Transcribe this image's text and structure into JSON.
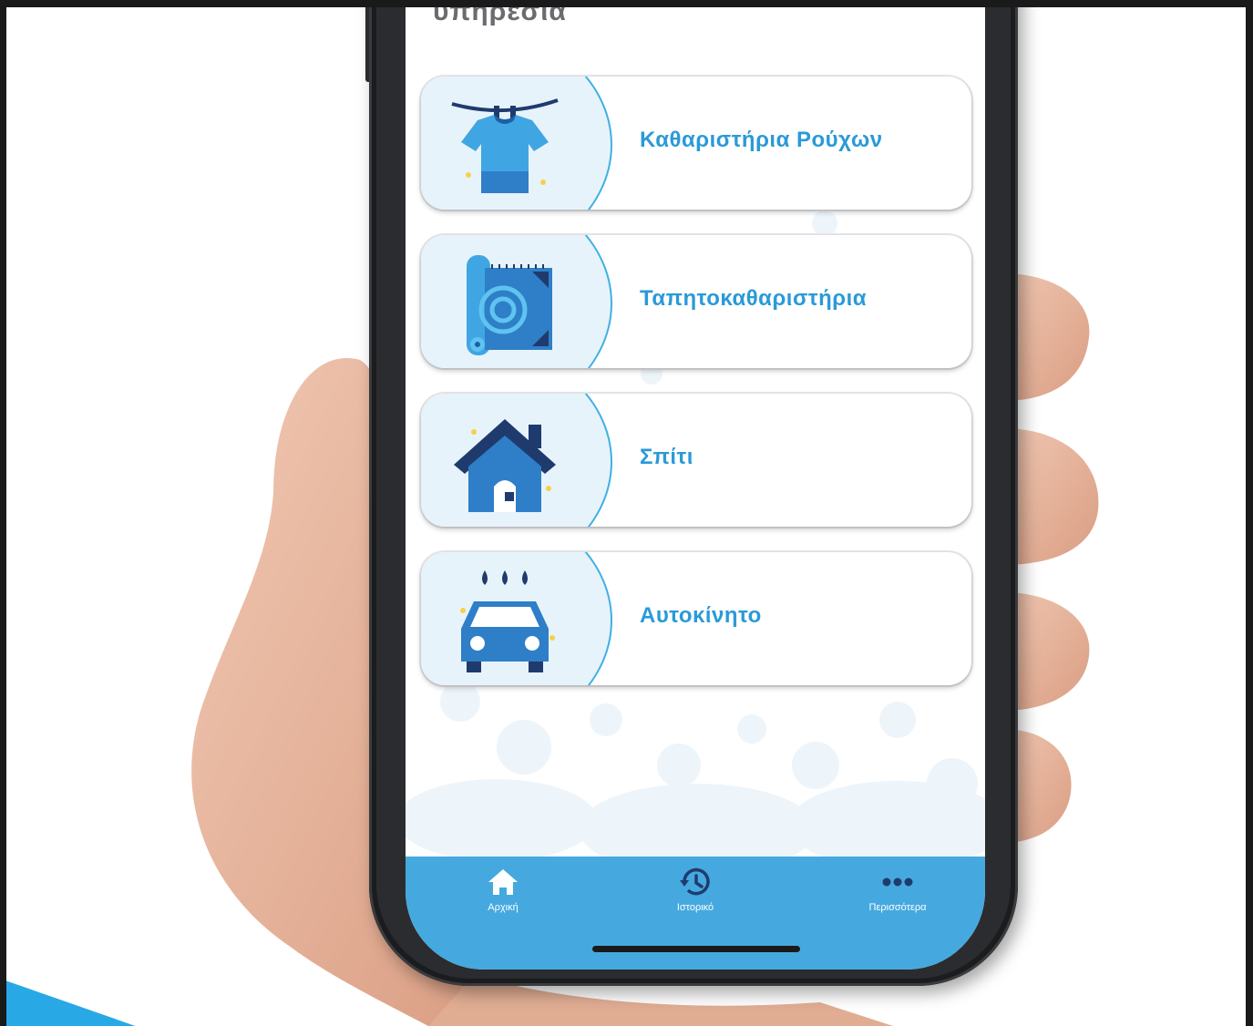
{
  "screen": {
    "title": "υπηρεσία"
  },
  "services": [
    {
      "label": "Καθαριστήρια Ρούχων",
      "icon": "tshirt-icon"
    },
    {
      "label": "Ταπητοκαθαριστήρια",
      "icon": "carpet-icon"
    },
    {
      "label": "Σπίτι",
      "icon": "house-icon"
    },
    {
      "label": "Αυτοκίνητο",
      "icon": "car-wash-icon"
    }
  ],
  "tabbar": {
    "items": [
      {
        "label": "Αρχική",
        "icon": "home-icon"
      },
      {
        "label": "Ιστορικό",
        "icon": "history-icon"
      },
      {
        "label": "Περισσότερα",
        "icon": "more-icon"
      }
    ]
  },
  "colors": {
    "accent": "#2a9ad8",
    "tabbar": "#45a9df",
    "skin": "#e9b9a0"
  }
}
